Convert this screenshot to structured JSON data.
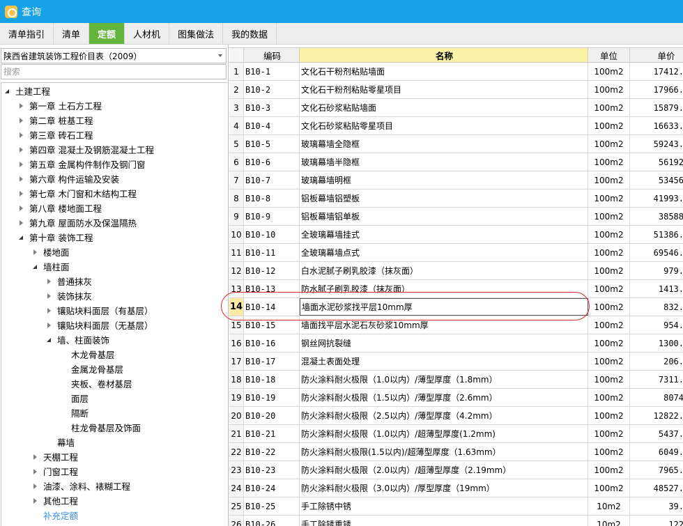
{
  "window": {
    "title": "查询"
  },
  "tabs": [
    {
      "label": "清单指引",
      "active": false
    },
    {
      "label": "清单",
      "active": false
    },
    {
      "label": "定额",
      "active": true
    },
    {
      "label": "人材机",
      "active": false
    },
    {
      "label": "图集做法",
      "active": false
    },
    {
      "label": "我的数据",
      "active": false
    }
  ],
  "left": {
    "library": "陕西省建筑装饰工程价目表（2009）",
    "search_placeholder": "搜索",
    "tree": [
      {
        "label": "土建工程",
        "depth": 0,
        "state": "open"
      },
      {
        "label": "第一章 土石方工程",
        "depth": 1,
        "state": "closed"
      },
      {
        "label": "第二章 桩基工程",
        "depth": 1,
        "state": "closed"
      },
      {
        "label": "第三章 砖石工程",
        "depth": 1,
        "state": "closed"
      },
      {
        "label": "第四章 混凝土及钢筋混凝土工程",
        "depth": 1,
        "state": "closed"
      },
      {
        "label": "第五章 金属构件制作及钢门窗",
        "depth": 1,
        "state": "closed"
      },
      {
        "label": "第六章 构件运输及安装",
        "depth": 1,
        "state": "closed"
      },
      {
        "label": "第七章 木门窗和木结构工程",
        "depth": 1,
        "state": "closed"
      },
      {
        "label": "第八章 楼地面工程",
        "depth": 1,
        "state": "closed"
      },
      {
        "label": "第九章 屋面防水及保温隔热",
        "depth": 1,
        "state": "closed"
      },
      {
        "label": "第十章 装饰工程",
        "depth": 1,
        "state": "open"
      },
      {
        "label": "楼地面",
        "depth": 2,
        "state": "closed"
      },
      {
        "label": "墙柱面",
        "depth": 2,
        "state": "open"
      },
      {
        "label": "普通抹灰",
        "depth": 3,
        "state": "closed"
      },
      {
        "label": "装饰抹灰",
        "depth": 3,
        "state": "closed"
      },
      {
        "label": "镶贴块料面层（有基层）",
        "depth": 3,
        "state": "closed"
      },
      {
        "label": "镶贴块料面层（无基层）",
        "depth": 3,
        "state": "closed"
      },
      {
        "label": "墙、柱面装饰",
        "depth": 3,
        "state": "open"
      },
      {
        "label": "木龙骨基层",
        "depth": 4,
        "state": "none"
      },
      {
        "label": "金属龙骨基层",
        "depth": 4,
        "state": "none"
      },
      {
        "label": "夹板、卷材基层",
        "depth": 4,
        "state": "none"
      },
      {
        "label": "面层",
        "depth": 4,
        "state": "none"
      },
      {
        "label": "隔断",
        "depth": 4,
        "state": "none"
      },
      {
        "label": "柱龙骨基层及饰面",
        "depth": 4,
        "state": "none"
      },
      {
        "label": "幕墙",
        "depth": 3,
        "state": "none"
      },
      {
        "label": "天棚工程",
        "depth": 2,
        "state": "closed"
      },
      {
        "label": "门窗工程",
        "depth": 2,
        "state": "closed"
      },
      {
        "label": "油漆、涂料、裱糊工程",
        "depth": 2,
        "state": "closed"
      },
      {
        "label": "其他工程",
        "depth": 2,
        "state": "closed"
      },
      {
        "label": "补充定额",
        "depth": 2,
        "state": "none",
        "color": "#3a8fe8"
      },
      {
        "label": "第十一章 总体工程",
        "depth": 1,
        "state": "closed"
      }
    ]
  },
  "table": {
    "headers": {
      "code": "编码",
      "name": "名称",
      "unit": "单位",
      "price": "单价"
    },
    "rows": [
      {
        "n": "1",
        "code": "B10-1",
        "name": "文化石干粉剂粘贴墙面",
        "unit": "100m2",
        "price": "17412."
      },
      {
        "n": "2",
        "code": "B10-2",
        "name": "文化石干粉剂粘贴零星项目",
        "unit": "100m2",
        "price": "17966."
      },
      {
        "n": "3",
        "code": "B10-3",
        "name": "文化石砂浆粘贴墙面",
        "unit": "100m2",
        "price": "15879."
      },
      {
        "n": "4",
        "code": "B10-4",
        "name": "文化石砂浆粘贴零星项目",
        "unit": "100m2",
        "price": "16633."
      },
      {
        "n": "5",
        "code": "B10-5",
        "name": "玻璃幕墙全隐框",
        "unit": "100m2",
        "price": "59243."
      },
      {
        "n": "6",
        "code": "B10-6",
        "name": "玻璃幕墙半隐框",
        "unit": "100m2",
        "price": "56192"
      },
      {
        "n": "7",
        "code": "B10-7",
        "name": "玻璃幕墙明框",
        "unit": "100m2",
        "price": "53456"
      },
      {
        "n": "8",
        "code": "B10-8",
        "name": "铝板幕墙铝塑板",
        "unit": "100m2",
        "price": "41993."
      },
      {
        "n": "9",
        "code": "B10-9",
        "name": "铝板幕墙铝单板",
        "unit": "100m2",
        "price": "38588"
      },
      {
        "n": "10",
        "code": "B10-10",
        "name": "全玻璃幕墙挂式",
        "unit": "100m2",
        "price": "51386."
      },
      {
        "n": "11",
        "code": "B10-11",
        "name": "全玻璃幕墙点式",
        "unit": "100m2",
        "price": "69546."
      },
      {
        "n": "12",
        "code": "B10-12",
        "name": "白水泥腻子刷乳胶漆（抹灰面）",
        "unit": "100m2",
        "price": "979."
      },
      {
        "n": "13",
        "code": "B10-13",
        "name": "防水腻子刷乳胶漆（抹灰面）",
        "unit": "100m2",
        "price": "1413."
      },
      {
        "n": "14",
        "code": "B10-14",
        "name": "墙面水泥砂浆找平层10mm厚",
        "unit": "100m2",
        "price": "832.",
        "selected": true
      },
      {
        "n": "15",
        "code": "B10-15",
        "name": "墙面找平层水泥石灰砂浆10mm厚",
        "unit": "100m2",
        "price": "954."
      },
      {
        "n": "16",
        "code": "B10-16",
        "name": "钢丝网抗裂缝",
        "unit": "100m2",
        "price": "1300."
      },
      {
        "n": "17",
        "code": "B10-17",
        "name": "混凝土表面处理",
        "unit": "100m2",
        "price": "206."
      },
      {
        "n": "18",
        "code": "B10-18",
        "name": "防火涂料耐火极限（1.0以内）/薄型厚度（1.8mm）",
        "unit": "100m2",
        "price": "7311."
      },
      {
        "n": "19",
        "code": "B10-19",
        "name": "防火涂料耐火极限（1.5以内）/薄型厚度（2.6mm）",
        "unit": "100m2",
        "price": "8074"
      },
      {
        "n": "20",
        "code": "B10-20",
        "name": "防火涂料耐火极限（2.5以内）/薄型厚度（4.2mm）",
        "unit": "100m2",
        "price": "12822."
      },
      {
        "n": "21",
        "code": "B10-21",
        "name": "防火涂料耐火极限（1.0以内）/超薄型厚度(1.2mm)",
        "unit": "100m2",
        "price": "5437."
      },
      {
        "n": "22",
        "code": "B10-22",
        "name": "防火涂料耐火极限(1.5以内)/超薄型厚度（1.63mm）",
        "unit": "100m2",
        "price": "6049."
      },
      {
        "n": "23",
        "code": "B10-23",
        "name": "防火涂料耐火极限（2.0以内）/超薄型厚度（2.19mm）",
        "unit": "100m2",
        "price": "7965."
      },
      {
        "n": "24",
        "code": "B10-24",
        "name": "防火涂料耐火极限（3.0以内）/厚型厚度（19mm）",
        "unit": "100m2",
        "price": "48527."
      },
      {
        "n": "25",
        "code": "B10-25",
        "name": "手工除锈中锈",
        "unit": "10m2",
        "price": "39."
      },
      {
        "n": "26",
        "code": "B10-26",
        "name": "手工除锈重锈",
        "unit": "10m2",
        "price": "122"
      }
    ]
  }
}
